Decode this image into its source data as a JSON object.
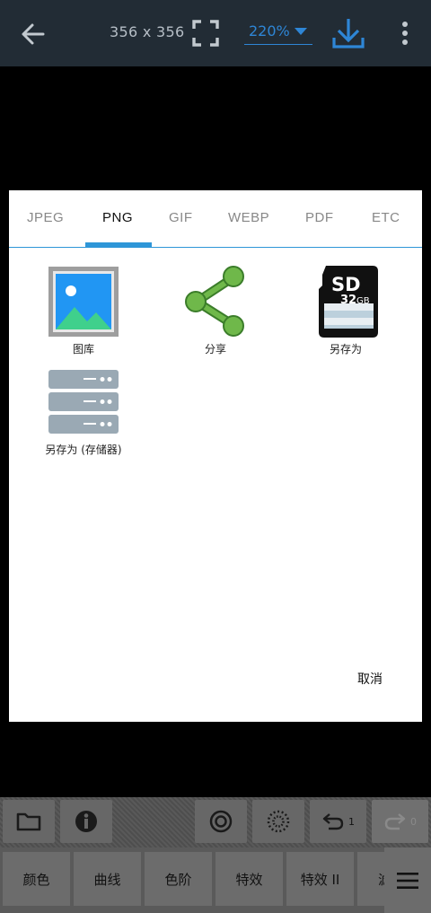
{
  "topbar": {
    "dimensions": "356 x 356",
    "zoom": "220%"
  },
  "dialog": {
    "tabs": [
      "JPEG",
      "PNG",
      "GIF",
      "WEBP",
      "PDF",
      "ETC"
    ],
    "active_tab": "PNG",
    "items": {
      "gallery": "图库",
      "share": "分享",
      "save_as": "另存为",
      "save_as_storage": "另存为 (存储器)"
    },
    "sd_card": {
      "brand": "SD",
      "capacity": "32",
      "unit": "GB"
    },
    "cancel": "取消"
  },
  "toolbar": {
    "undo_count": "1",
    "redo_count": "0"
  },
  "filters": [
    "颜色",
    "曲线",
    "色阶",
    "特效",
    "特效 II",
    "滤"
  ],
  "colors": {
    "accent": "#2e96d8",
    "share_green": "#6fb84a",
    "topbar": "#222c35"
  }
}
